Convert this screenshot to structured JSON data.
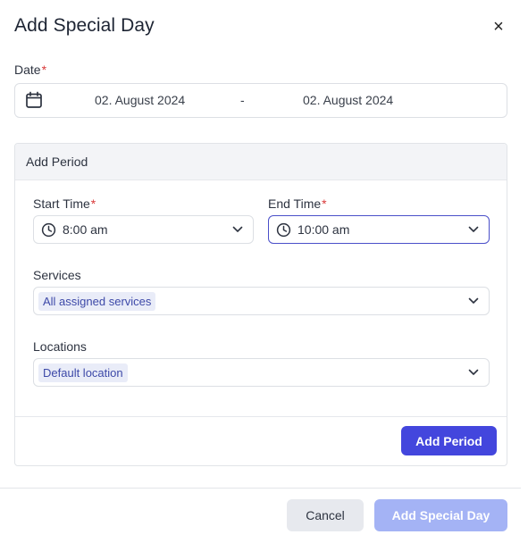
{
  "dialog": {
    "title": "Add Special Day",
    "close_glyph": "×"
  },
  "date": {
    "label": "Date",
    "required_mark": "*",
    "icon": "calendar-icon",
    "start": "02. August 2024",
    "separator": "-",
    "end": "02. August 2024"
  },
  "period": {
    "header": "Add Period",
    "start_time": {
      "label": "Start Time",
      "required_mark": "*",
      "icon": "clock-icon",
      "value": "8:00 am"
    },
    "end_time": {
      "label": "End Time",
      "required_mark": "*",
      "icon": "clock-icon",
      "value": "10:00 am",
      "focused": true
    },
    "services": {
      "label": "Services",
      "selected_tag": "All assigned services"
    },
    "locations": {
      "label": "Locations",
      "selected_tag": "Default location"
    },
    "add_button": "Add Period"
  },
  "footer": {
    "cancel_label": "Cancel",
    "submit_label": "Add Special Day",
    "submit_disabled": true
  },
  "colors": {
    "primary": "#4346dd",
    "primary_disabled": "#a4b3f5",
    "required": "#d93a3a",
    "tag_bg": "#e9ecf8",
    "tag_text": "#3d49a8"
  }
}
